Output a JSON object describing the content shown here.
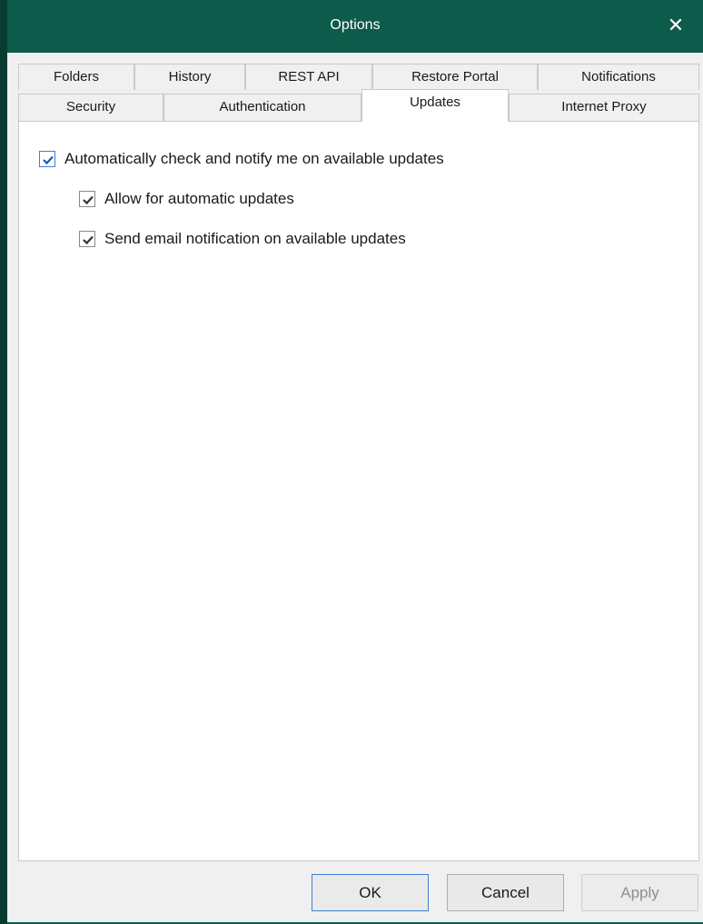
{
  "window": {
    "title": "Options",
    "close_glyph": "✕"
  },
  "tabs_row1": [
    "Folders",
    "History",
    "REST API",
    "Restore Portal",
    "Notifications"
  ],
  "tabs_row2": [
    "Security",
    "Authentication",
    "Updates",
    "Internet Proxy"
  ],
  "active_tab": "Updates",
  "updates": {
    "auto_check": {
      "label": "Automatically check and notify me on available updates",
      "checked": true
    },
    "allow_auto": {
      "label": "Allow for automatic updates",
      "checked": true
    },
    "send_email": {
      "label": "Send email notification on available updates",
      "checked": true
    }
  },
  "buttons": {
    "ok": "OK",
    "cancel": "Cancel",
    "apply": "Apply"
  },
  "colors": {
    "titlebar": "#0d5b4a",
    "accent_blue": "#3c7fd3"
  }
}
